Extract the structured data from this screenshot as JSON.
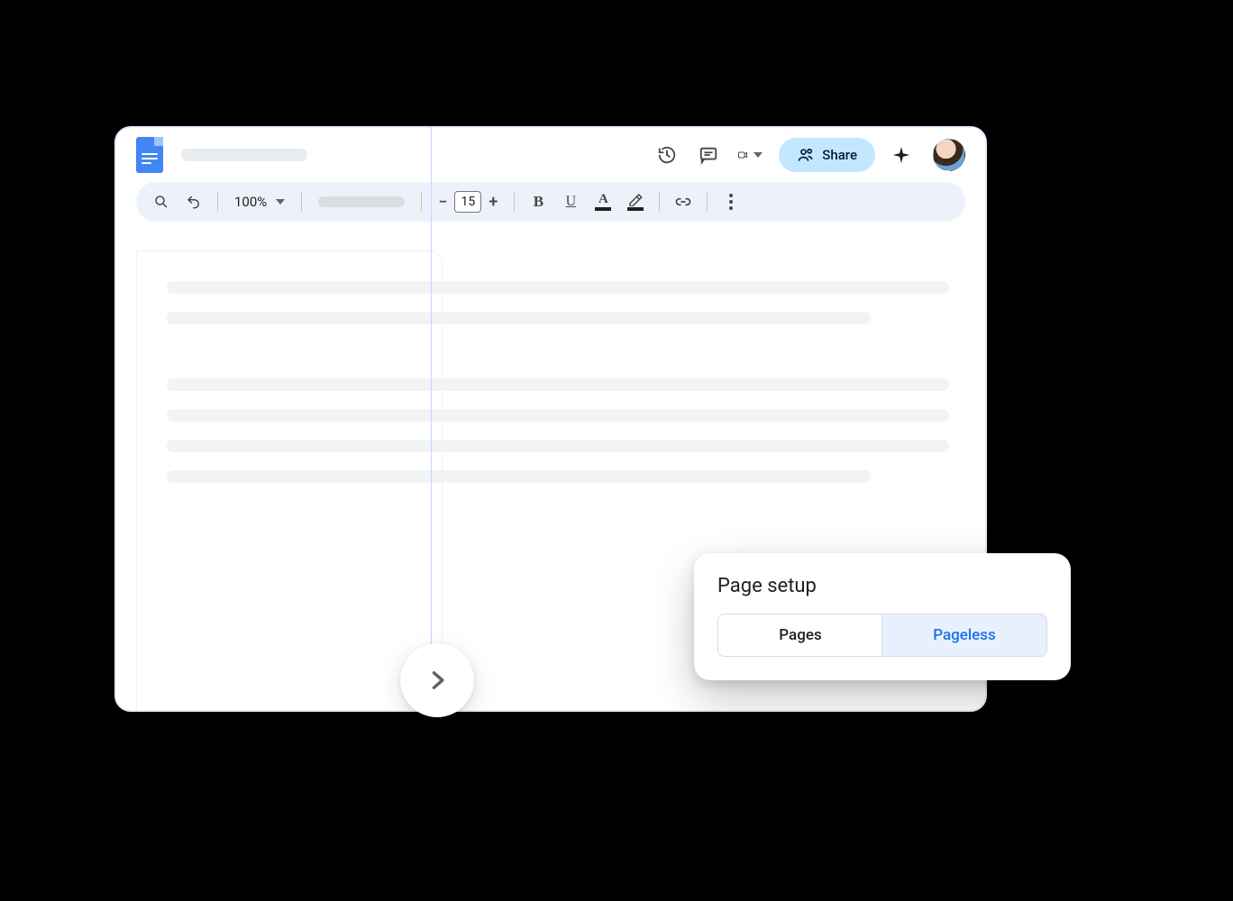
{
  "toolbar": {
    "zoom_label": "100%",
    "font_size": "15"
  },
  "header": {
    "share_label": "Share"
  },
  "page_setup": {
    "title": "Page setup",
    "options": [
      "Pages",
      "Pageless"
    ],
    "active_index": 1
  },
  "icons": {
    "docs_logo": "docs-logo",
    "history": "history-icon",
    "comment": "comment-icon",
    "video": "video-icon",
    "share_people": "people-icon",
    "sparkle": "sparkle-icon",
    "avatar": "avatar",
    "search": "search-icon",
    "undo": "undo-icon",
    "bold": "bold-icon",
    "underline": "underline-icon",
    "text_color": "text-color-icon",
    "highlight": "highlight-icon",
    "link": "link-icon",
    "more": "more-icon",
    "expand_arrow": "chevron-right-icon",
    "caret": "caret-down-icon",
    "minus": "minus-icon",
    "plus": "plus-icon"
  }
}
